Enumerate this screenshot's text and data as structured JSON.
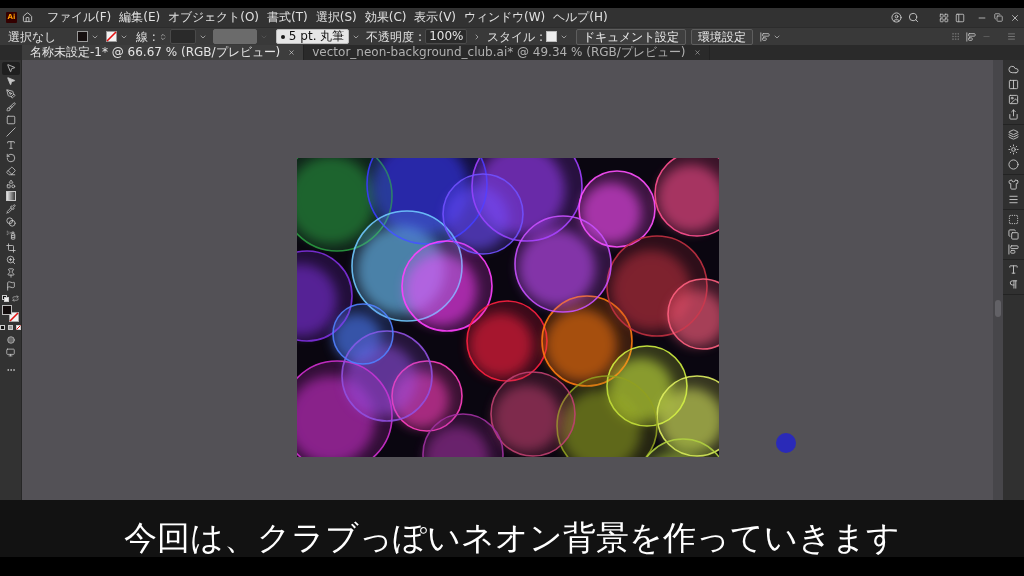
{
  "menu_bar": {
    "logo": "Ai",
    "items": [
      "ファイル(F)",
      "編集(E)",
      "オブジェクト(O)",
      "書式(T)",
      "選択(S)",
      "効果(C)",
      "表示(V)",
      "ウィンドウ(W)",
      "ヘルプ(H)"
    ]
  },
  "control_bar": {
    "selection": "選択なし",
    "stroke_label": "線 :",
    "brush": "5 pt. 丸筆",
    "opacity_label": "不透明度 :",
    "opacity_value": "100%",
    "style_label": "スタイル :",
    "buttons": [
      "ドキュメント設定",
      "環境設定"
    ]
  },
  "tabs": [
    {
      "label": "名称未設定-1* @ 66.67 % (RGB/プレビュー)",
      "selected": true
    },
    {
      "label": "vector_neon-background_club.ai* @ 49.34 % (RGB/プレビュー)",
      "selected": false
    }
  ],
  "tools": [
    {
      "selected": true
    },
    {
      "selected": false
    },
    {
      "selected": false
    },
    {
      "selected": false
    },
    {
      "selected": false
    },
    {
      "selected": false
    },
    {
      "selected": false
    },
    {
      "selected": false
    },
    {
      "selected": false
    },
    {
      "selected": false
    },
    {
      "selected": false
    },
    {
      "selected": false
    },
    {
      "selected": false
    },
    {
      "selected": false
    },
    {
      "selected": false
    },
    {
      "selected": false
    },
    {
      "selected": false
    },
    {
      "selected": false
    }
  ],
  "caption": "今回は、クラブっぽいネオン背景を作っていきます"
}
